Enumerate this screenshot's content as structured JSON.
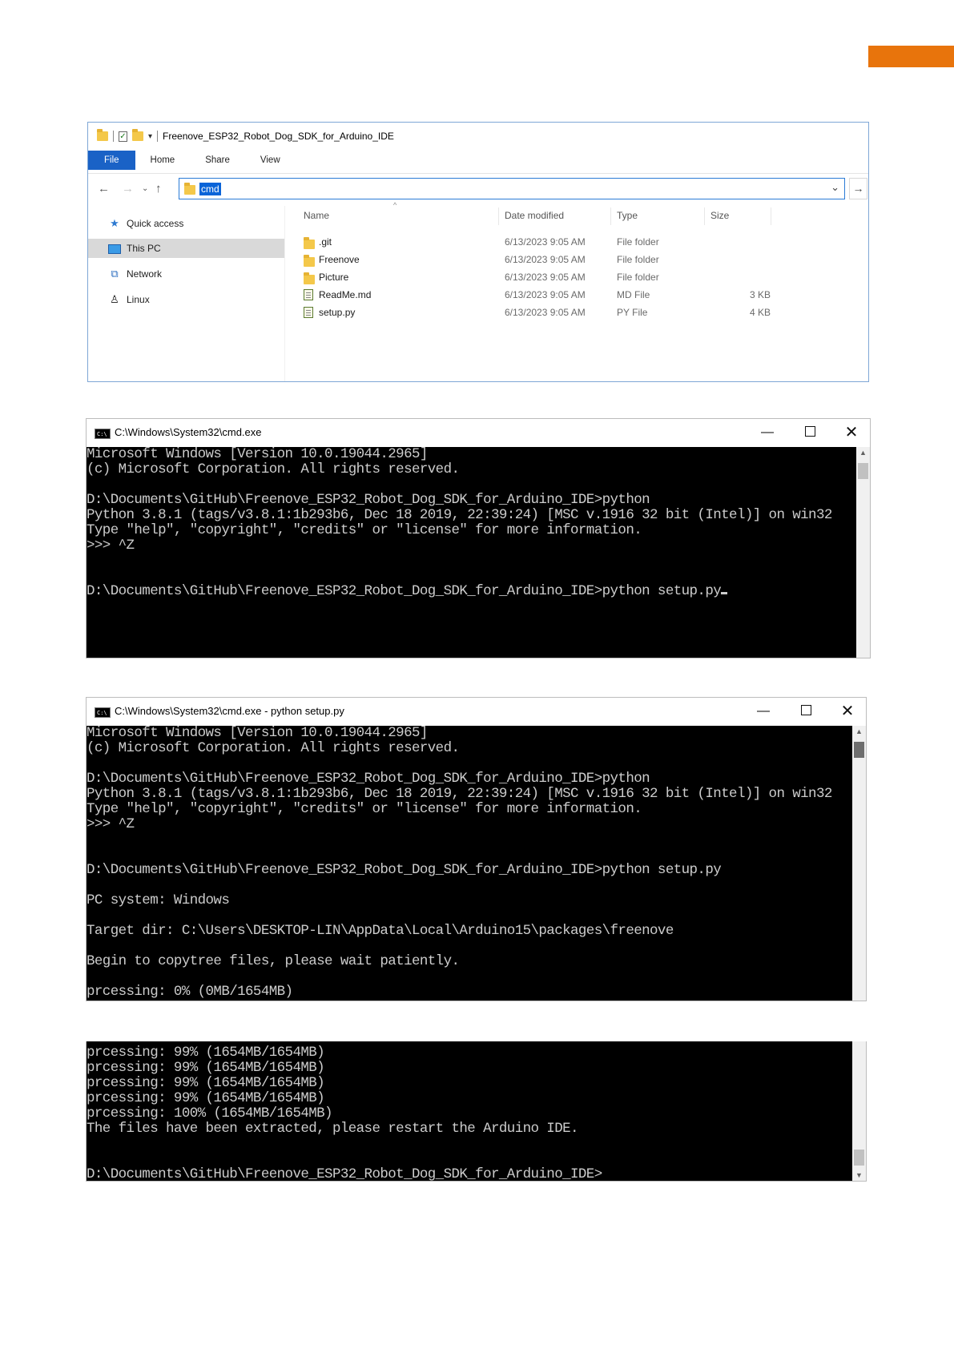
{
  "explorer": {
    "title": "Freenove_ESP32_Robot_Dog_SDK_for_Arduino_IDE",
    "ribbon_tabs": [
      "File",
      "Home",
      "Share",
      "View"
    ],
    "address_value": "cmd",
    "nav_items": [
      "Quick access",
      "This PC",
      "Network",
      "Linux"
    ],
    "columns": {
      "name": "Name",
      "date": "Date modified",
      "type": "Type",
      "size": "Size"
    },
    "files": [
      {
        "name": ".git",
        "date": "6/13/2023 9:05 AM",
        "type": "File folder",
        "size": "",
        "icon": "folder-icon"
      },
      {
        "name": "Freenove",
        "date": "6/13/2023 9:05 AM",
        "type": "File folder",
        "size": "",
        "icon": "folder-icon"
      },
      {
        "name": "Picture",
        "date": "6/13/2023 9:05 AM",
        "type": "File folder",
        "size": "",
        "icon": "folder-icon"
      },
      {
        "name": "ReadMe.md",
        "date": "6/13/2023 9:05 AM",
        "type": "MD File",
        "size": "3 KB",
        "icon": "file-icon"
      },
      {
        "name": "setup.py",
        "date": "6/13/2023 9:05 AM",
        "type": "PY File",
        "size": "4 KB",
        "icon": "file-icon"
      }
    ]
  },
  "cmd1": {
    "title": "C:\\Windows\\System32\\cmd.exe",
    "lines": [
      "Microsoft Windows [Version 10.0.19044.2965]",
      "(c) Microsoft Corporation. All rights reserved.",
      "",
      "D:\\Documents\\GitHub\\Freenove_ESP32_Robot_Dog_SDK_for_Arduino_IDE>python",
      "Python 3.8.1 (tags/v3.8.1:1b293b6, Dec 18 2019, 22:39:24) [MSC v.1916 32 bit (Intel)] on win32",
      "Type \"help\", \"copyright\", \"credits\" or \"license\" for more information.",
      ">>> ^Z",
      "",
      "",
      "D:\\Documents\\GitHub\\Freenove_ESP32_Robot_Dog_SDK_for_Arduino_IDE>python setup.py"
    ]
  },
  "cmd2": {
    "title": "C:\\Windows\\System32\\cmd.exe - python  setup.py",
    "lines": [
      "Microsoft Windows [Version 10.0.19044.2965]",
      "(c) Microsoft Corporation. All rights reserved.",
      "",
      "D:\\Documents\\GitHub\\Freenove_ESP32_Robot_Dog_SDK_for_Arduino_IDE>python",
      "Python 3.8.1 (tags/v3.8.1:1b293b6, Dec 18 2019, 22:39:24) [MSC v.1916 32 bit (Intel)] on win32",
      "Type \"help\", \"copyright\", \"credits\" or \"license\" for more information.",
      ">>> ^Z",
      "",
      "",
      "D:\\Documents\\GitHub\\Freenove_ESP32_Robot_Dog_SDK_for_Arduino_IDE>python setup.py",
      "",
      "PC system: Windows",
      "",
      "Target dir: C:\\Users\\DESKTOP-LIN\\AppData\\Local\\Arduino15\\packages\\freenove",
      "",
      "Begin to copytree files, please wait patiently.",
      "",
      "prcessing: 0% (0MB/1654MB)"
    ]
  },
  "cmd3": {
    "lines": [
      "prcessing: 99% (1654MB/1654MB)",
      "prcessing: 99% (1654MB/1654MB)",
      "prcessing: 99% (1654MB/1654MB)",
      "prcessing: 99% (1654MB/1654MB)",
      "prcessing: 100% (1654MB/1654MB)",
      "The files have been extracted, please restart the Arduino IDE.",
      "",
      "",
      "D:\\Documents\\GitHub\\Freenove_ESP32_Robot_Dog_SDK_for_Arduino_IDE>"
    ]
  },
  "colors": {
    "accent": "#e8740c",
    "file_tab": "#1a62c6",
    "selection": "#0a64d8",
    "console_bg": "#000000",
    "console_fg": "#cccccc"
  }
}
